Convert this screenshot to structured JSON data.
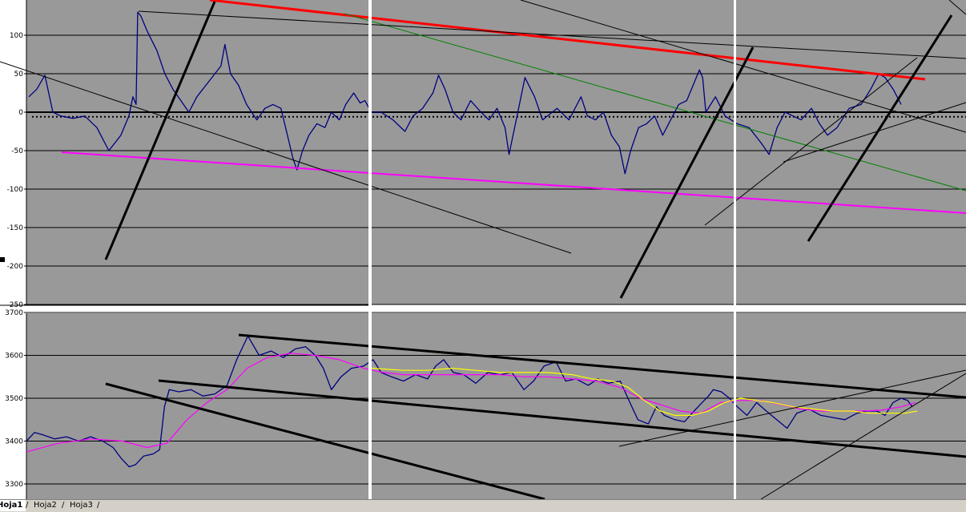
{
  "colors": {
    "plot_bg": "#999999",
    "gridline": "#000000",
    "price_line": "#000080",
    "ma_magenta": "#ff00ff",
    "ma_yellow": "#ffff00",
    "trend_red": "#ff0000",
    "trend_green": "#008000",
    "trend_black": "#000000",
    "trend_magenta": "#ff00ff",
    "separator": "#ffffff"
  },
  "chart_data": [
    {
      "type": "line",
      "title": "",
      "xlabel": "",
      "ylabel": "",
      "ylim": [
        -250,
        130
      ],
      "ytick_labels": [
        "100",
        "50",
        "0",
        "-50",
        "-100",
        "-150",
        "-200",
        "-250"
      ],
      "ytick_values": [
        100,
        50,
        0,
        -50,
        -100,
        -150,
        -200,
        -250
      ],
      "grid": true,
      "baseline_dotted_value": -6,
      "series": [
        {
          "color": "#000080",
          "points": [
            [
              0,
              20
            ],
            [
              10,
              30
            ],
            [
              20,
              48
            ],
            [
              30,
              0
            ],
            [
              40,
              -5
            ],
            [
              55,
              -8
            ],
            [
              70,
              -5
            ],
            [
              85,
              -20
            ],
            [
              100,
              -50
            ],
            [
              115,
              -30
            ],
            [
              125,
              -5
            ],
            [
              130,
              20
            ],
            [
              134,
              10
            ],
            [
              136,
              130
            ],
            [
              140,
              125
            ],
            [
              148,
              105
            ],
            [
              160,
              80
            ],
            [
              170,
              50
            ],
            [
              180,
              30
            ],
            [
              190,
              15
            ],
            [
              200,
              0
            ],
            [
              210,
              20
            ],
            [
              225,
              40
            ],
            [
              240,
              60
            ],
            [
              245,
              88
            ],
            [
              252,
              50
            ],
            [
              262,
              35
            ],
            [
              272,
              10
            ],
            [
              285,
              -10
            ],
            [
              295,
              5
            ],
            [
              305,
              10
            ],
            [
              315,
              5
            ],
            [
              322,
              -25
            ],
            [
              330,
              -60
            ],
            [
              335,
              -75
            ],
            [
              342,
              -50
            ],
            [
              350,
              -30
            ],
            [
              360,
              -15
            ],
            [
              370,
              -20
            ],
            [
              378,
              0
            ],
            [
              388,
              -10
            ],
            [
              396,
              10
            ],
            [
              406,
              25
            ],
            [
              414,
              12
            ],
            [
              420,
              15
            ],
            [
              428,
              0
            ],
            [
              440,
              0
            ],
            [
              455,
              -10
            ],
            [
              470,
              -25
            ],
            [
              480,
              -5
            ],
            [
              492,
              5
            ],
            [
              505,
              25
            ],
            [
              512,
              48
            ],
            [
              520,
              30
            ],
            [
              530,
              0
            ],
            [
              540,
              -10
            ],
            [
              552,
              15
            ],
            [
              565,
              0
            ],
            [
              575,
              -10
            ],
            [
              585,
              5
            ],
            [
              595,
              -20
            ],
            [
              600,
              -55
            ],
            [
              610,
              -5
            ],
            [
              620,
              45
            ],
            [
              632,
              20
            ],
            [
              642,
              -10
            ],
            [
              660,
              5
            ],
            [
              675,
              -10
            ],
            [
              690,
              20
            ],
            [
              698,
              -5
            ],
            [
              708,
              -10
            ],
            [
              718,
              0
            ],
            [
              728,
              -30
            ],
            [
              738,
              -45
            ],
            [
              745,
              -80
            ],
            [
              752,
              -50
            ],
            [
              762,
              -20
            ],
            [
              772,
              -15
            ],
            [
              782,
              -5
            ],
            [
              792,
              -30
            ],
            [
              802,
              -10
            ],
            [
              812,
              10
            ],
            [
              822,
              15
            ],
            [
              832,
              40
            ],
            [
              838,
              55
            ],
            [
              842,
              45
            ],
            [
              846,
              0
            ],
            [
              858,
              20
            ],
            [
              870,
              -5
            ],
            [
              885,
              -15
            ],
            [
              900,
              -20
            ],
            [
              915,
              -40
            ],
            [
              925,
              -55
            ],
            [
              935,
              -20
            ],
            [
              945,
              0
            ],
            [
              955,
              -5
            ],
            [
              965,
              -10
            ],
            [
              978,
              5
            ],
            [
              988,
              -15
            ],
            [
              998,
              -30
            ],
            [
              1010,
              -20
            ],
            [
              1025,
              5
            ],
            [
              1040,
              10
            ],
            [
              1052,
              30
            ],
            [
              1062,
              50
            ],
            [
              1070,
              45
            ],
            [
              1080,
              30
            ],
            [
              1090,
              10
            ]
          ]
        }
      ]
    },
    {
      "type": "line",
      "title": "",
      "xlabel": "",
      "ylabel": "",
      "ylim": [
        3270,
        3700
      ],
      "ytick_labels": [
        "3700",
        "3600",
        "3500",
        "3400",
        "3300"
      ],
      "ytick_values": [
        3700,
        3600,
        3500,
        3400,
        3300
      ],
      "grid": true,
      "series": [
        {
          "color": "#000080",
          "points": [
            [
              0,
              3400
            ],
            [
              10,
              3420
            ],
            [
              20,
              3415
            ],
            [
              35,
              3405
            ],
            [
              50,
              3410
            ],
            [
              65,
              3400
            ],
            [
              80,
              3410
            ],
            [
              95,
              3400
            ],
            [
              108,
              3385
            ],
            [
              118,
              3360
            ],
            [
              128,
              3340
            ],
            [
              136,
              3345
            ],
            [
              146,
              3365
            ],
            [
              158,
              3370
            ],
            [
              166,
              3380
            ],
            [
              172,
              3480
            ],
            [
              178,
              3520
            ],
            [
              190,
              3515
            ],
            [
              205,
              3520
            ],
            [
              220,
              3505
            ],
            [
              235,
              3510
            ],
            [
              250,
              3530
            ],
            [
              262,
              3590
            ],
            [
              276,
              3645
            ],
            [
              290,
              3600
            ],
            [
              305,
              3610
            ],
            [
              320,
              3595
            ],
            [
              335,
              3615
            ],
            [
              348,
              3620
            ],
            [
              360,
              3600
            ],
            [
              370,
              3570
            ],
            [
              380,
              3520
            ],
            [
              392,
              3550
            ],
            [
              405,
              3570
            ],
            [
              420,
              3575
            ],
            [
              432,
              3590
            ],
            [
              442,
              3560
            ],
            [
              455,
              3550
            ],
            [
              470,
              3540
            ],
            [
              485,
              3555
            ],
            [
              500,
              3545
            ],
            [
              510,
              3575
            ],
            [
              520,
              3590
            ],
            [
              532,
              3560
            ],
            [
              545,
              3555
            ],
            [
              560,
              3535
            ],
            [
              575,
              3560
            ],
            [
              590,
              3555
            ],
            [
              605,
              3560
            ],
            [
              620,
              3520
            ],
            [
              632,
              3540
            ],
            [
              645,
              3575
            ],
            [
              660,
              3585
            ],
            [
              672,
              3540
            ],
            [
              685,
              3545
            ],
            [
              700,
              3530
            ],
            [
              712,
              3545
            ],
            [
              725,
              3535
            ],
            [
              740,
              3540
            ],
            [
              752,
              3490
            ],
            [
              762,
              3450
            ],
            [
              775,
              3440
            ],
            [
              785,
              3480
            ],
            [
              795,
              3460
            ],
            [
              808,
              3450
            ],
            [
              820,
              3445
            ],
            [
              832,
              3470
            ],
            [
              842,
              3490
            ],
            [
              850,
              3505
            ],
            [
              856,
              3520
            ],
            [
              866,
              3515
            ],
            [
              876,
              3500
            ],
            [
              886,
              3480
            ],
            [
              898,
              3460
            ],
            [
              910,
              3490
            ],
            [
              922,
              3470
            ],
            [
              935,
              3450
            ],
            [
              948,
              3430
            ],
            [
              960,
              3465
            ],
            [
              975,
              3475
            ],
            [
              990,
              3460
            ],
            [
              1005,
              3455
            ],
            [
              1020,
              3450
            ],
            [
              1035,
              3465
            ],
            [
              1048,
              3470
            ],
            [
              1060,
              3470
            ],
            [
              1070,
              3460
            ],
            [
              1080,
              3490
            ],
            [
              1090,
              3500
            ],
            [
              1098,
              3495
            ],
            [
              1104,
              3480
            ]
          ]
        },
        {
          "color": "#ff00ff",
          "points": [
            [
              0,
              3375
            ],
            [
              40,
              3395
            ],
            [
              80,
              3405
            ],
            [
              120,
              3400
            ],
            [
              150,
              3385
            ],
            [
              175,
              3395
            ],
            [
              200,
              3450
            ],
            [
              225,
              3490
            ],
            [
              250,
              3520
            ],
            [
              275,
              3570
            ],
            [
              300,
              3595
            ],
            [
              330,
              3605
            ],
            [
              360,
              3600
            ],
            [
              390,
              3590
            ],
            [
              420,
              3570
            ],
            [
              445,
              3560
            ],
            [
              470,
              3555
            ],
            [
              500,
              3555
            ],
            [
              530,
              3555
            ],
            [
              560,
              3555
            ],
            [
              590,
              3555
            ],
            [
              620,
              3550
            ],
            [
              650,
              3550
            ],
            [
              680,
              3545
            ],
            [
              710,
              3540
            ],
            [
              740,
              3525
            ],
            [
              765,
              3500
            ],
            [
              790,
              3485
            ],
            [
              815,
              3470
            ],
            [
              840,
              3465
            ],
            [
              865,
              3490
            ],
            [
              890,
              3495
            ],
            [
              915,
              3495
            ],
            [
              940,
              3485
            ],
            [
              965,
              3475
            ],
            [
              990,
              3470
            ],
            [
              1015,
              3470
            ],
            [
              1040,
              3470
            ],
            [
              1065,
              3472
            ],
            [
              1090,
              3480
            ],
            [
              1108,
              3490
            ]
          ]
        },
        {
          "color": "#ffff00",
          "points": [
            [
              430,
              3570
            ],
            [
              470,
              3565
            ],
            [
              500,
              3565
            ],
            [
              530,
              3570
            ],
            [
              560,
              3565
            ],
            [
              590,
              3560
            ],
            [
              620,
              3560
            ],
            [
              650,
              3560
            ],
            [
              680,
              3555
            ],
            [
              705,
              3545
            ],
            [
              730,
              3540
            ],
            [
              750,
              3525
            ],
            [
              770,
              3495
            ],
            [
              790,
              3470
            ],
            [
              808,
              3460
            ],
            [
              830,
              3460
            ],
            [
              850,
              3470
            ],
            [
              870,
              3490
            ],
            [
              890,
              3500
            ],
            [
              910,
              3495
            ],
            [
              930,
              3490
            ],
            [
              955,
              3480
            ],
            [
              980,
              3475
            ],
            [
              1005,
              3470
            ],
            [
              1030,
              3470
            ],
            [
              1050,
              3465
            ],
            [
              1075,
              3465
            ],
            [
              1095,
              3465
            ],
            [
              1110,
              3470
            ]
          ]
        }
      ]
    }
  ],
  "sheet_tabs": [
    "Hoja1",
    "Hoja2",
    "Hoja3"
  ],
  "active_tab": "Hoja1"
}
